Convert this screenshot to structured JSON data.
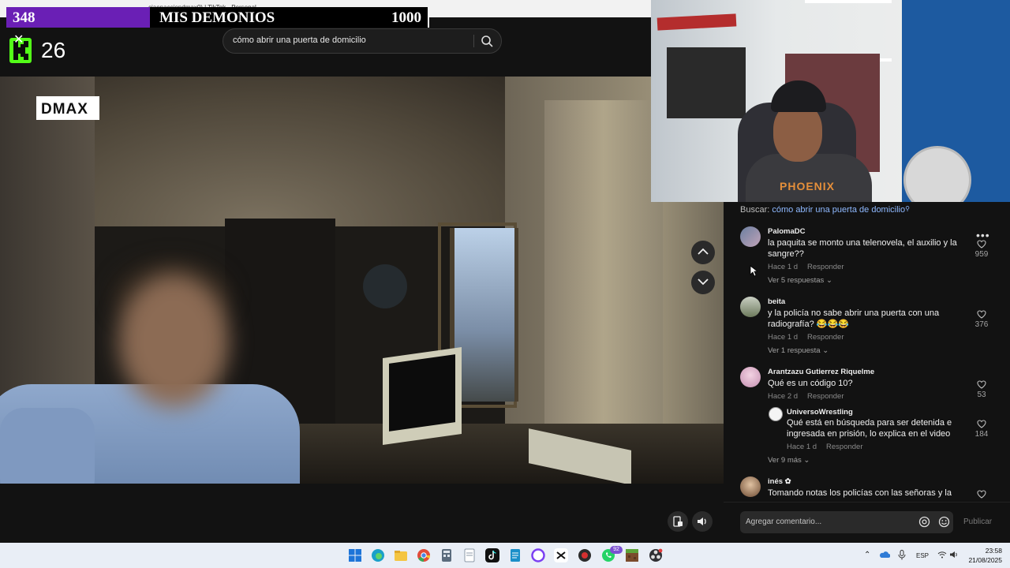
{
  "browser": {
    "title": "ciaenacciondmax0) | TikTok - Personal"
  },
  "stream_overlay": {
    "left_counter": "348",
    "title": "MIS DEMONIOS",
    "right_counter": "1000",
    "viewer_count": "26"
  },
  "search": {
    "query": "cómo abrir una puerta de domicilio"
  },
  "video": {
    "channel_logo": "DMAX",
    "webcam_shirt_text": "PHOENIX"
  },
  "comments_panel": {
    "search_label": "Buscar:",
    "search_link": "cómo abrir una puerta de domicilio",
    "comments": [
      {
        "user": "PalomaDC",
        "text": "la paquita se monto una telenovela, el auxilio y la sangre??",
        "time": "Hace 1 d",
        "reply_label": "Responder",
        "likes": "959",
        "more": "Ver 5 respuestas"
      },
      {
        "user": "beita",
        "text": "y la policía no sabe abrir una puerta con una radiografía? 😂😂😂",
        "time": "Hace 1 d",
        "reply_label": "Responder",
        "likes": "376",
        "more": "Ver 1 respuesta"
      },
      {
        "user": "Arantzazu Gutierrez Riquelme",
        "text": "Qué es un código 10?",
        "time": "Hace 2 d",
        "reply_label": "Responder",
        "likes": "53",
        "reply": {
          "user": "UniversoWrestling",
          "text": "Qué está en búsqueda para ser detenida e ingresada en prisión, lo explica en el video",
          "time": "Hace 1 d",
          "reply_label": "Responder",
          "likes": "184"
        },
        "more": "Ver 9 más"
      },
      {
        "user": "inés ✿",
        "text": "Tomando notas los policías con las señoras y la",
        "likes": ""
      }
    ],
    "input_placeholder": "Agregar comentario...",
    "publish_label": "Publicar"
  },
  "taskbar": {
    "language": "ESP",
    "time": "23:58",
    "date": "21/08/2025",
    "whatsapp_badge": "92"
  },
  "colors": {
    "stream_purple": "#6a1fb5",
    "kick_green": "#53fc18",
    "link_blue": "#8fb9ff",
    "panel_bg": "#121212",
    "taskbar_bg": "#e9eef6"
  }
}
